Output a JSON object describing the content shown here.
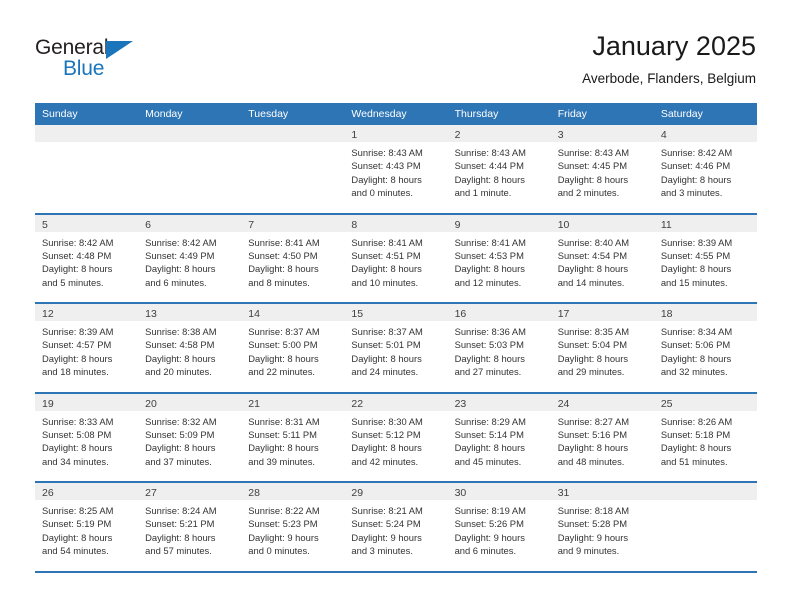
{
  "logo": {
    "word_top": "General",
    "word_bottom": "Blue",
    "triangle_icon": "logo-triangle-icon",
    "accent_color": "#1b75bb"
  },
  "header": {
    "title": "January 2025",
    "subtitle": "Averbode, Flanders, Belgium"
  },
  "colors": {
    "header_blue": "#2e75b6",
    "day_band_gray": "#efefef",
    "text": "#333333"
  },
  "weekdays": [
    "Sunday",
    "Monday",
    "Tuesday",
    "Wednesday",
    "Thursday",
    "Friday",
    "Saturday"
  ],
  "weeks": [
    [
      {
        "day": "",
        "lines": []
      },
      {
        "day": "",
        "lines": []
      },
      {
        "day": "",
        "lines": []
      },
      {
        "day": "1",
        "lines": [
          "Sunrise: 8:43 AM",
          "Sunset: 4:43 PM",
          "Daylight: 8 hours",
          "and 0 minutes."
        ]
      },
      {
        "day": "2",
        "lines": [
          "Sunrise: 8:43 AM",
          "Sunset: 4:44 PM",
          "Daylight: 8 hours",
          "and 1 minute."
        ]
      },
      {
        "day": "3",
        "lines": [
          "Sunrise: 8:43 AM",
          "Sunset: 4:45 PM",
          "Daylight: 8 hours",
          "and 2 minutes."
        ]
      },
      {
        "day": "4",
        "lines": [
          "Sunrise: 8:42 AM",
          "Sunset: 4:46 PM",
          "Daylight: 8 hours",
          "and 3 minutes."
        ]
      }
    ],
    [
      {
        "day": "5",
        "lines": [
          "Sunrise: 8:42 AM",
          "Sunset: 4:48 PM",
          "Daylight: 8 hours",
          "and 5 minutes."
        ]
      },
      {
        "day": "6",
        "lines": [
          "Sunrise: 8:42 AM",
          "Sunset: 4:49 PM",
          "Daylight: 8 hours",
          "and 6 minutes."
        ]
      },
      {
        "day": "7",
        "lines": [
          "Sunrise: 8:41 AM",
          "Sunset: 4:50 PM",
          "Daylight: 8 hours",
          "and 8 minutes."
        ]
      },
      {
        "day": "8",
        "lines": [
          "Sunrise: 8:41 AM",
          "Sunset: 4:51 PM",
          "Daylight: 8 hours",
          "and 10 minutes."
        ]
      },
      {
        "day": "9",
        "lines": [
          "Sunrise: 8:41 AM",
          "Sunset: 4:53 PM",
          "Daylight: 8 hours",
          "and 12 minutes."
        ]
      },
      {
        "day": "10",
        "lines": [
          "Sunrise: 8:40 AM",
          "Sunset: 4:54 PM",
          "Daylight: 8 hours",
          "and 14 minutes."
        ]
      },
      {
        "day": "11",
        "lines": [
          "Sunrise: 8:39 AM",
          "Sunset: 4:55 PM",
          "Daylight: 8 hours",
          "and 15 minutes."
        ]
      }
    ],
    [
      {
        "day": "12",
        "lines": [
          "Sunrise: 8:39 AM",
          "Sunset: 4:57 PM",
          "Daylight: 8 hours",
          "and 18 minutes."
        ]
      },
      {
        "day": "13",
        "lines": [
          "Sunrise: 8:38 AM",
          "Sunset: 4:58 PM",
          "Daylight: 8 hours",
          "and 20 minutes."
        ]
      },
      {
        "day": "14",
        "lines": [
          "Sunrise: 8:37 AM",
          "Sunset: 5:00 PM",
          "Daylight: 8 hours",
          "and 22 minutes."
        ]
      },
      {
        "day": "15",
        "lines": [
          "Sunrise: 8:37 AM",
          "Sunset: 5:01 PM",
          "Daylight: 8 hours",
          "and 24 minutes."
        ]
      },
      {
        "day": "16",
        "lines": [
          "Sunrise: 8:36 AM",
          "Sunset: 5:03 PM",
          "Daylight: 8 hours",
          "and 27 minutes."
        ]
      },
      {
        "day": "17",
        "lines": [
          "Sunrise: 8:35 AM",
          "Sunset: 5:04 PM",
          "Daylight: 8 hours",
          "and 29 minutes."
        ]
      },
      {
        "day": "18",
        "lines": [
          "Sunrise: 8:34 AM",
          "Sunset: 5:06 PM",
          "Daylight: 8 hours",
          "and 32 minutes."
        ]
      }
    ],
    [
      {
        "day": "19",
        "lines": [
          "Sunrise: 8:33 AM",
          "Sunset: 5:08 PM",
          "Daylight: 8 hours",
          "and 34 minutes."
        ]
      },
      {
        "day": "20",
        "lines": [
          "Sunrise: 8:32 AM",
          "Sunset: 5:09 PM",
          "Daylight: 8 hours",
          "and 37 minutes."
        ]
      },
      {
        "day": "21",
        "lines": [
          "Sunrise: 8:31 AM",
          "Sunset: 5:11 PM",
          "Daylight: 8 hours",
          "and 39 minutes."
        ]
      },
      {
        "day": "22",
        "lines": [
          "Sunrise: 8:30 AM",
          "Sunset: 5:12 PM",
          "Daylight: 8 hours",
          "and 42 minutes."
        ]
      },
      {
        "day": "23",
        "lines": [
          "Sunrise: 8:29 AM",
          "Sunset: 5:14 PM",
          "Daylight: 8 hours",
          "and 45 minutes."
        ]
      },
      {
        "day": "24",
        "lines": [
          "Sunrise: 8:27 AM",
          "Sunset: 5:16 PM",
          "Daylight: 8 hours",
          "and 48 minutes."
        ]
      },
      {
        "day": "25",
        "lines": [
          "Sunrise: 8:26 AM",
          "Sunset: 5:18 PM",
          "Daylight: 8 hours",
          "and 51 minutes."
        ]
      }
    ],
    [
      {
        "day": "26",
        "lines": [
          "Sunrise: 8:25 AM",
          "Sunset: 5:19 PM",
          "Daylight: 8 hours",
          "and 54 minutes."
        ]
      },
      {
        "day": "27",
        "lines": [
          "Sunrise: 8:24 AM",
          "Sunset: 5:21 PM",
          "Daylight: 8 hours",
          "and 57 minutes."
        ]
      },
      {
        "day": "28",
        "lines": [
          "Sunrise: 8:22 AM",
          "Sunset: 5:23 PM",
          "Daylight: 9 hours",
          "and 0 minutes."
        ]
      },
      {
        "day": "29",
        "lines": [
          "Sunrise: 8:21 AM",
          "Sunset: 5:24 PM",
          "Daylight: 9 hours",
          "and 3 minutes."
        ]
      },
      {
        "day": "30",
        "lines": [
          "Sunrise: 8:19 AM",
          "Sunset: 5:26 PM",
          "Daylight: 9 hours",
          "and 6 minutes."
        ]
      },
      {
        "day": "31",
        "lines": [
          "Sunrise: 8:18 AM",
          "Sunset: 5:28 PM",
          "Daylight: 9 hours",
          "and 9 minutes."
        ]
      },
      {
        "day": "",
        "lines": []
      }
    ]
  ]
}
